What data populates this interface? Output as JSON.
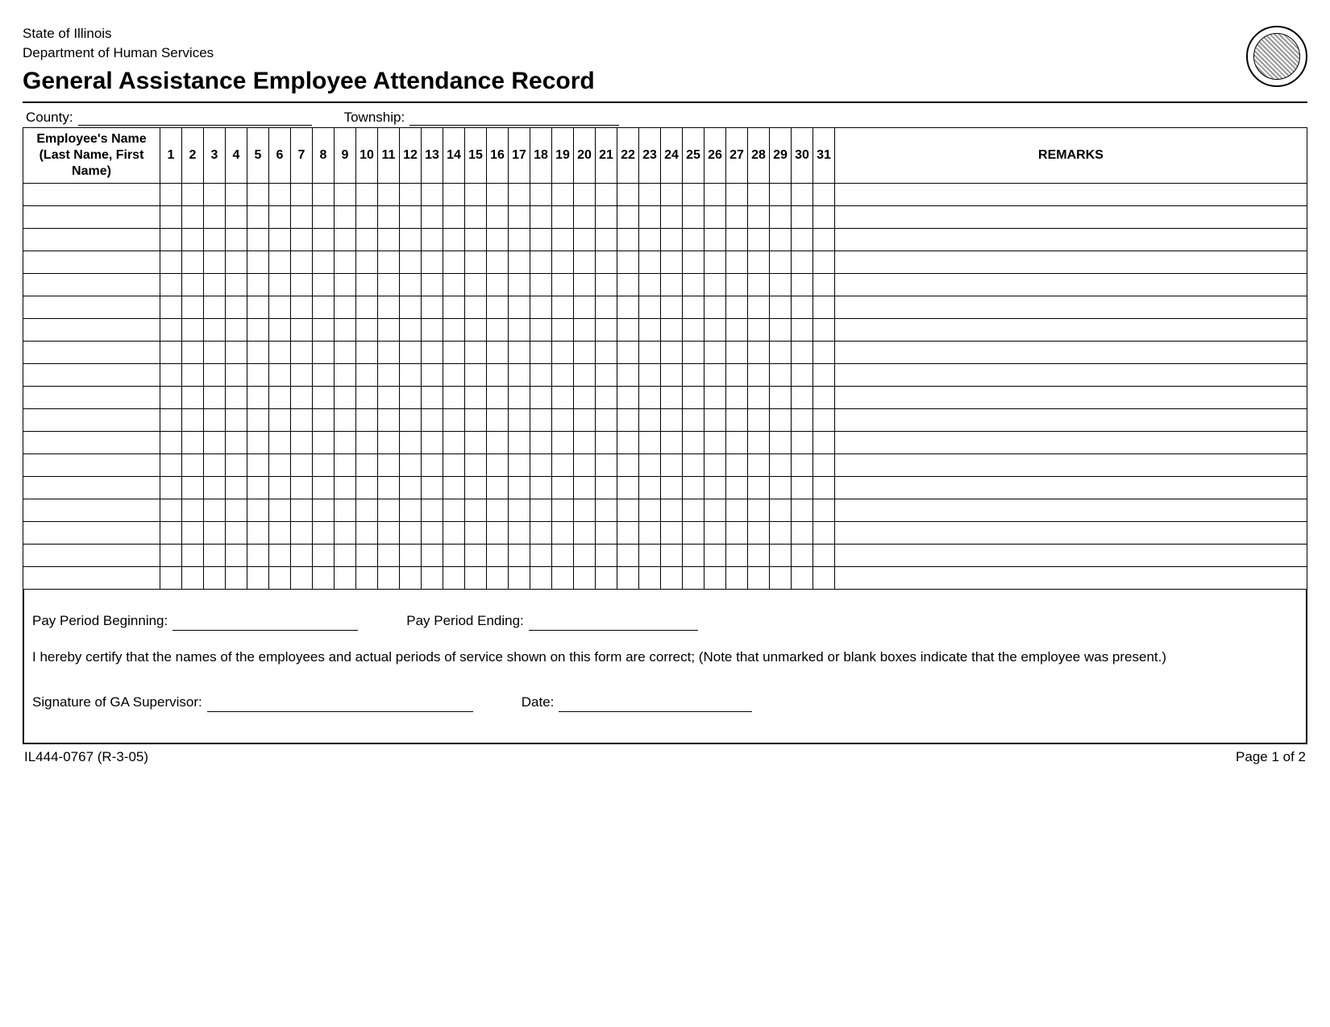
{
  "header": {
    "state": "State of Illinois",
    "dept": "Department of Human Services",
    "title": "General Assistance Employee Attendance Record"
  },
  "location": {
    "county_label": "County:",
    "township_label": "Township:"
  },
  "table": {
    "name_header": "Employee's Name (Last Name, First Name)",
    "days": [
      "1",
      "2",
      "3",
      "4",
      "5",
      "6",
      "7",
      "8",
      "9",
      "10",
      "11",
      "12",
      "13",
      "14",
      "15",
      "16",
      "17",
      "18",
      "19",
      "20",
      "21",
      "22",
      "23",
      "24",
      "25",
      "26",
      "27",
      "28",
      "29",
      "30",
      "31"
    ],
    "remarks_header": "REMARKS",
    "row_count": 18
  },
  "bottom": {
    "pp_begin": "Pay Period Beginning:",
    "pp_end": "Pay Period Ending:",
    "certification": "I hereby certify that the names of the employees and actual periods of service shown on this form are correct;  (Note that unmarked or blank boxes indicate that the employee was present.)",
    "sig_label": "Signature of GA Supervisor:",
    "date_label": "Date:"
  },
  "footer": {
    "form_id": "IL444-0767 (R-3-05)",
    "page": "Page 1 of 2"
  }
}
